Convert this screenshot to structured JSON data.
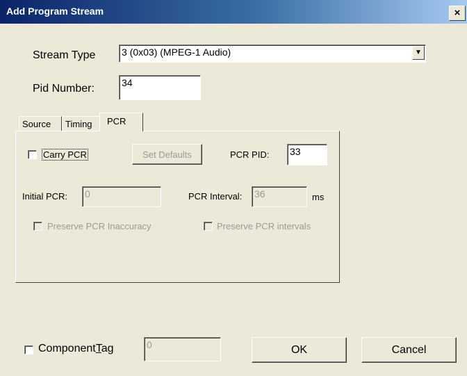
{
  "window": {
    "title": "Add Program Stream",
    "close_glyph": "×"
  },
  "stream_type": {
    "label": "Stream Type",
    "value": "3 (0x03) (MPEG-1 Audio)",
    "arrow": "▼"
  },
  "pid_number": {
    "label": "Pid Number:",
    "value": "34"
  },
  "tabs": [
    {
      "label": "Source",
      "active": false
    },
    {
      "label": "Timing",
      "active": false
    },
    {
      "label": "PCR",
      "active": true
    }
  ],
  "pcr": {
    "carry_pcr_label": "Carry PCR",
    "carry_pcr_checked": false,
    "set_defaults_label": "Set Defaults",
    "pcr_pid_label": "PCR PID:",
    "pcr_pid_value": "33",
    "initial_pcr_label": "Initial PCR:",
    "initial_pcr_value": "0",
    "pcr_interval_label": "PCR Interval:",
    "pcr_interval_value": "36",
    "pcr_interval_unit": "ms",
    "preserve_inaccuracy_label": "Preserve PCR Inaccuracy",
    "preserve_intervals_label": "Preserve PCR intervals"
  },
  "component_tag": {
    "label_pre": "Component",
    "label_accel": "T",
    "label_post": "ag",
    "checked": false,
    "value": "0"
  },
  "buttons": {
    "ok": "OK",
    "cancel": "Cancel"
  }
}
